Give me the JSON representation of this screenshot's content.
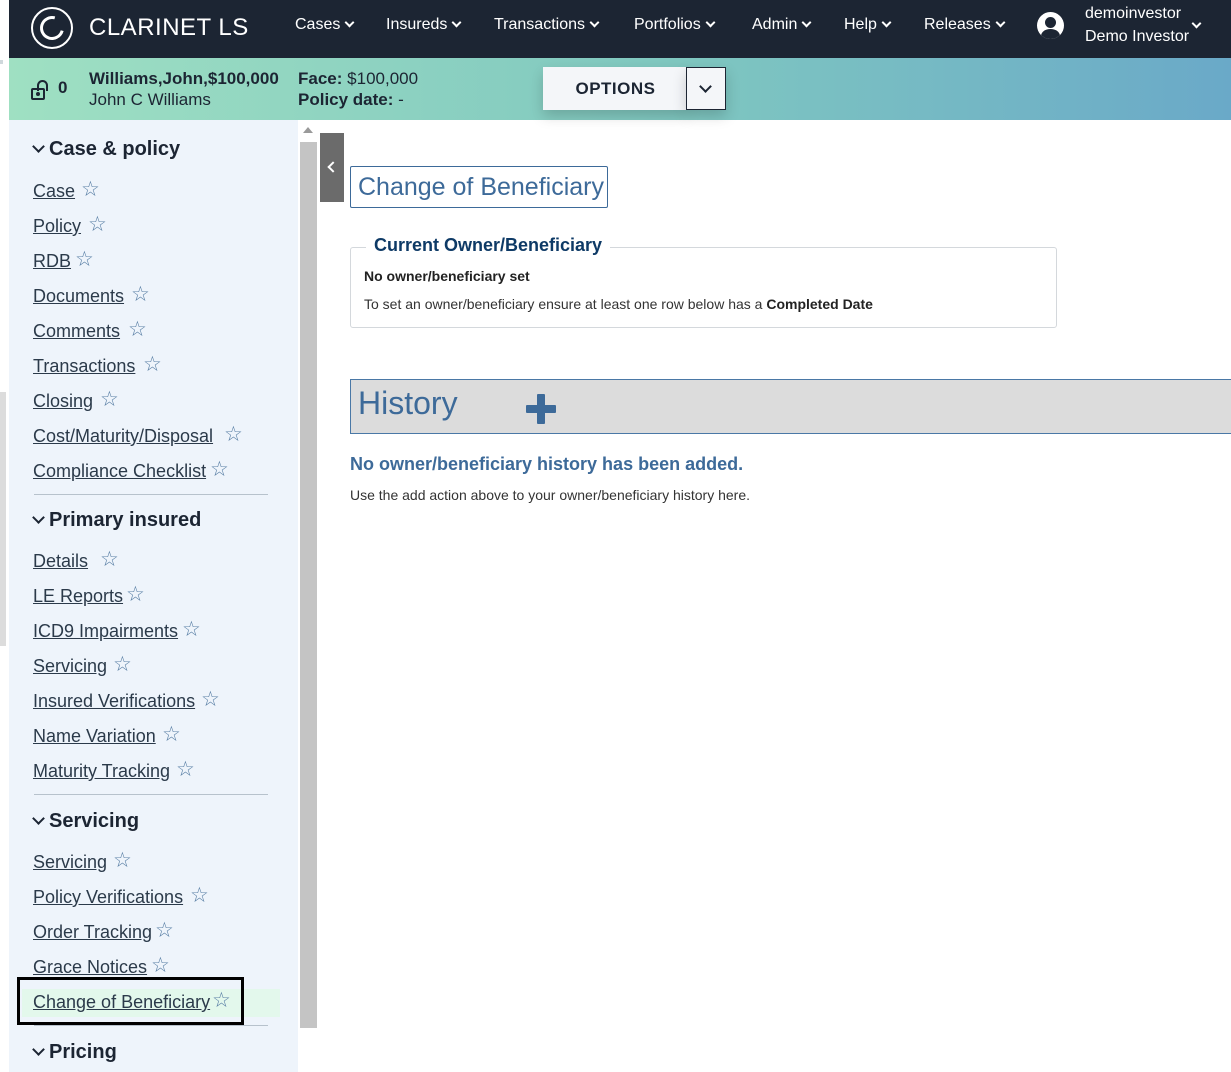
{
  "brand": {
    "name": "CLARINET LS"
  },
  "nav": {
    "items": [
      "Cases",
      "Insureds",
      "Transactions",
      "Portfolios",
      "Admin",
      "Help",
      "Releases"
    ]
  },
  "user": {
    "username": "demoinvestor",
    "display_name": "Demo Investor"
  },
  "case_header": {
    "lock_count": "0",
    "title": "Williams,John,$100,000",
    "insured_name": "John C Williams",
    "face_label": "Face:",
    "face_value": "$100,000",
    "policy_date_label": "Policy date:",
    "policy_date_value": "-",
    "options_label": "OPTIONS"
  },
  "sidebar": {
    "sections": [
      {
        "title": "Case & policy",
        "items": [
          "Case",
          "Policy",
          "RDB",
          "Documents",
          "Comments",
          "Transactions",
          "Closing",
          "Cost/Maturity/Disposal",
          "Compliance Checklist"
        ]
      },
      {
        "title": "Primary insured",
        "items": [
          "Details",
          "LE Reports",
          "ICD9 Impairments",
          "Servicing",
          "Insured Verifications",
          "Name Variation",
          "Maturity Tracking"
        ]
      },
      {
        "title": "Servicing",
        "items": [
          "Servicing",
          "Policy Verifications",
          "Order Tracking",
          "Grace Notices",
          "Change of Beneficiary"
        ]
      },
      {
        "title": "Pricing",
        "items": []
      }
    ],
    "active_item": "Change of Beneficiary"
  },
  "main": {
    "page_title": "Change of Beneficiary",
    "current": {
      "legend": "Current Owner/Beneficiary",
      "status": "No owner/beneficiary set",
      "hint_prefix": "To set an owner/beneficiary ensure at least one row below has a ",
      "hint_bold": "Completed Date"
    },
    "history": {
      "title": "History",
      "empty_title": "No owner/beneficiary history has been added.",
      "empty_sub": "Use the add action above to your owner/beneficiary history here."
    }
  },
  "icons": {
    "logo": "clarinet-logo-icon",
    "user": "user-circle-icon",
    "lock": "unlock-icon",
    "star": "star-outline-icon",
    "add": "plus-icon",
    "collapse": "chevron-left-icon"
  },
  "colors": {
    "nav_bg": "#1c2533",
    "accent_blue": "#3d6a99",
    "sidebar_bg": "#eef4fb",
    "case_bar_start": "#9fe0c2",
    "case_bar_end": "#6aa9c8"
  }
}
